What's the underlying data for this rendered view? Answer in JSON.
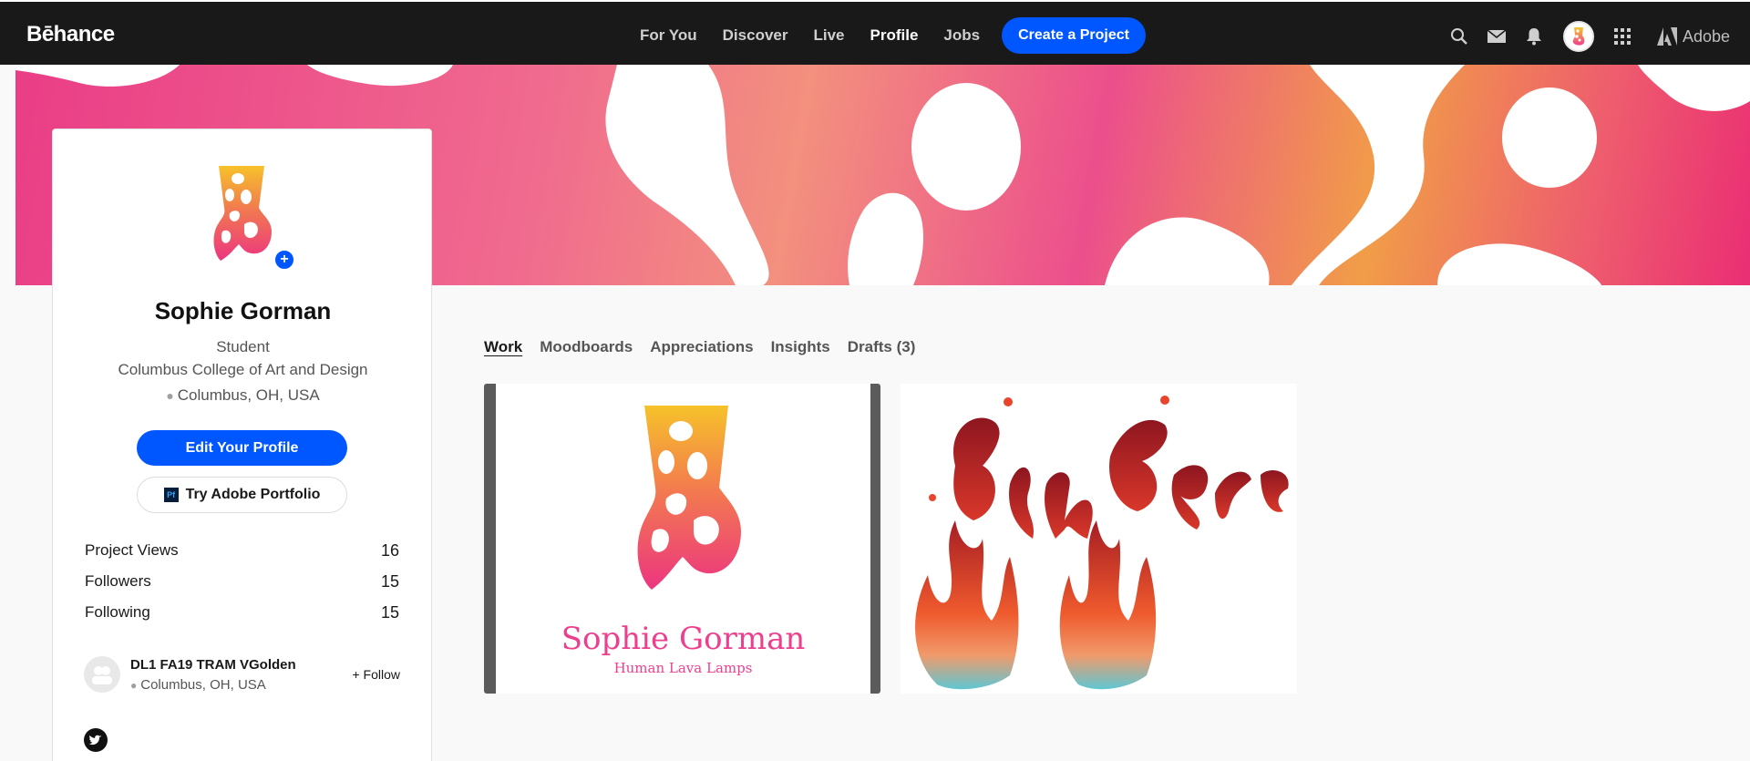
{
  "app": {
    "logo": "Bēhance"
  },
  "nav": {
    "items": [
      {
        "label": "For You"
      },
      {
        "label": "Discover"
      },
      {
        "label": "Live"
      },
      {
        "label": "Profile"
      },
      {
        "label": "Jobs"
      }
    ],
    "active": "Profile",
    "create_button": "Create a Project",
    "adobe_label": "Adobe",
    "icons": [
      "search-icon",
      "mail-icon",
      "bell-icon",
      "avatar",
      "apps-grid-icon",
      "adobe-logo-icon"
    ]
  },
  "profile": {
    "name": "Sophie Gorman",
    "occupation": "Student",
    "school": "Columbus College of Art and Design",
    "location": "Columbus, OH, USA",
    "edit_button": "Edit Your Profile",
    "portfolio_button": "Try Adobe Portfolio",
    "portfolio_badge": "Pf",
    "add_badge": "+"
  },
  "stats": [
    {
      "label": "Project Views",
      "value": "16"
    },
    {
      "label": "Followers",
      "value": "15"
    },
    {
      "label": "Following",
      "value": "15"
    }
  ],
  "team": {
    "name": "DL1 FA19 TRAM VGolden",
    "location": "Columbus, OH, USA",
    "follow_label": "+ Follow"
  },
  "tabs": [
    {
      "label": "Work"
    },
    {
      "label": "Moodboards"
    },
    {
      "label": "Appreciations"
    },
    {
      "label": "Insights"
    },
    {
      "label": "Drafts (3)"
    }
  ],
  "active_tab": "Work",
  "projects": [
    {
      "title": "Sophie Gorman",
      "subtitle": "Human Lava Lamps"
    },
    {
      "title": "Ginger"
    }
  ],
  "colors": {
    "accent": "#0057ff",
    "topbar": "#191919",
    "lava_pink": "#ee3f8d",
    "lava_yellow": "#f5c42a"
  }
}
